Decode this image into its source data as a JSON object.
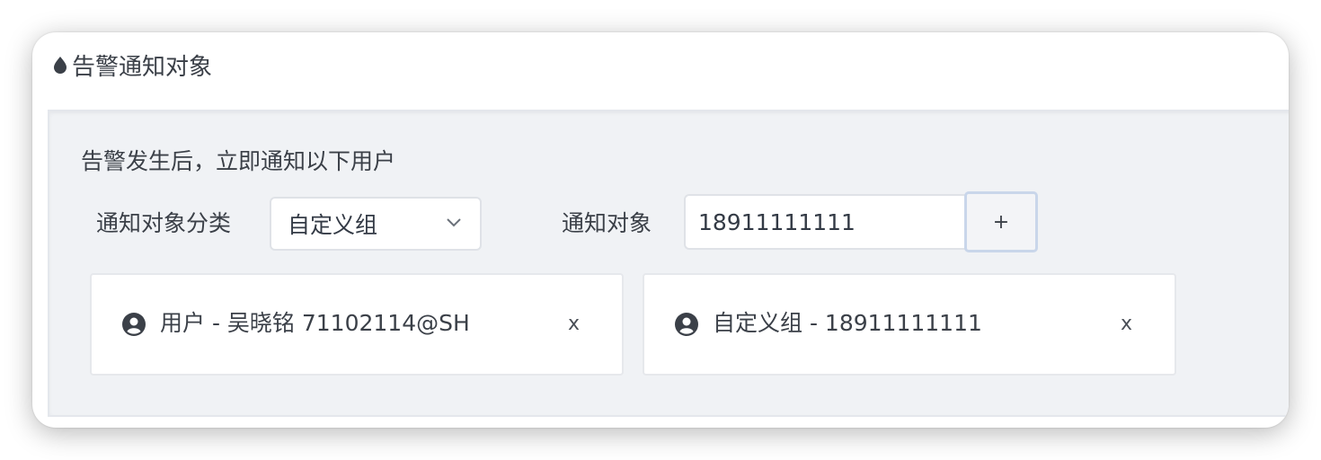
{
  "section": {
    "title": "告警通知对象"
  },
  "panel": {
    "description": "告警发生后，立即通知以下用户",
    "category_label": "通知对象分类",
    "category_selected": "自定义组",
    "target_label": "通知对象",
    "target_value": "18911111111",
    "add_label": "+"
  },
  "chips": [
    {
      "text": "用户 - 吴晓铭 71102114@SH",
      "close": "x",
      "icon": "user-circle-icon"
    },
    {
      "text": "自定义组 - 18911111111",
      "close": "x",
      "icon": "user-circle-icon"
    }
  ],
  "colors": {
    "panel_bg": "#f0f2f5",
    "icon": "#3b4048"
  }
}
